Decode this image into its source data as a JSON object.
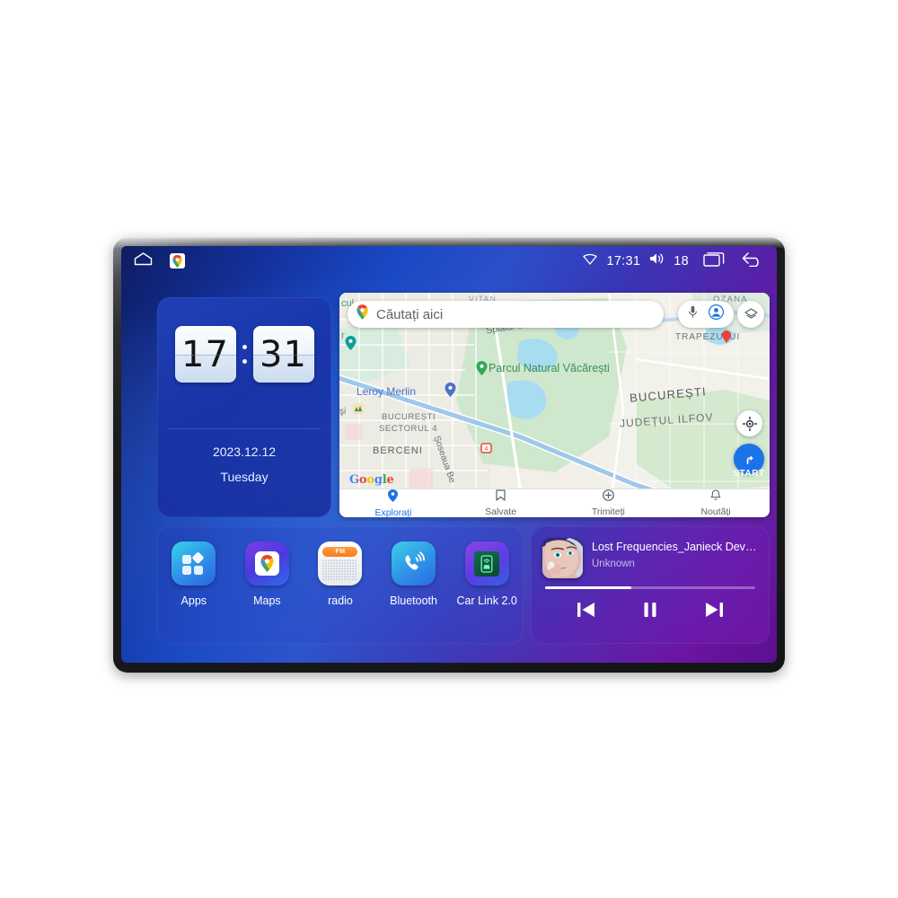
{
  "device": {
    "name": "car-head-unit"
  },
  "statusbar": {
    "home_icon": "home-icon",
    "maps_icon": "google-maps-icon",
    "wifi_icon": "wifi-icon",
    "time": "17:31",
    "volume_icon": "volume-icon",
    "volume_level": "18",
    "recents_icon": "recents-icon",
    "back_icon": "back-icon"
  },
  "clock_widget": {
    "hours": "17",
    "minutes": "31",
    "date": "2023.12.12",
    "weekday": "Tuesday"
  },
  "map": {
    "search": {
      "placeholder": "Căutați aici",
      "pin_icon": "map-pin-icon"
    },
    "mic_icon": "microphone-icon",
    "account_icon": "account-avatar-icon",
    "layers_icon": "map-layers-icon",
    "locate_icon": "my-location-icon",
    "start_icon": "navigation-arrow-icon",
    "start_label": "START",
    "attribution": "Google",
    "labels": [
      {
        "text": "Splaiul Unirii",
        "kind": "road"
      },
      {
        "text": "Parcul Natural Văcărești",
        "kind": "park"
      },
      {
        "text": "Leroy Merlin",
        "kind": "poi"
      },
      {
        "text": "BUCUREȘTI",
        "kind": "city"
      },
      {
        "text": "JUDEȚUL ILFOV",
        "kind": "county"
      },
      {
        "text": "TRAPEZULUI",
        "kind": "district"
      },
      {
        "text": "OZANA",
        "kind": "district"
      },
      {
        "text": "BUCUREȘTI",
        "kind": "district"
      },
      {
        "text": "SECTORUL 4",
        "kind": "district"
      },
      {
        "text": "BERCENI",
        "kind": "district"
      },
      {
        "text": "Șoseaua Be",
        "kind": "road"
      },
      {
        "text": "cul",
        "kind": "fragment"
      },
      {
        "text": "şi",
        "kind": "fragment"
      },
      {
        "text": "r",
        "kind": "fragment"
      },
      {
        "text": "VITAN",
        "kind": "district"
      }
    ],
    "bottom_nav": [
      {
        "label": "Explorați",
        "icon": "explore-pin-icon",
        "active": true
      },
      {
        "label": "Salvate",
        "icon": "bookmark-icon",
        "active": false
      },
      {
        "label": "Trimiteți",
        "icon": "contribute-plus-icon",
        "active": false
      },
      {
        "label": "Noutăți",
        "icon": "bell-icon",
        "active": false
      }
    ]
  },
  "apps": [
    {
      "label": "Apps",
      "icon": "apps-grid-icon"
    },
    {
      "label": "Maps",
      "icon": "google-maps-icon"
    },
    {
      "label": "radio",
      "icon": "fm-radio-icon",
      "badge": "FM"
    },
    {
      "label": "Bluetooth",
      "icon": "bluetooth-phone-icon"
    },
    {
      "label": "Car Link 2.0",
      "icon": "car-link-icon"
    }
  ],
  "music": {
    "title": "Lost Frequencies_Janieck Devy-...",
    "artist": "Unknown",
    "album_art": "album-artwork",
    "progress_percent": 41,
    "prev_icon": "previous-track-icon",
    "play_pause_icon": "pause-icon",
    "next_icon": "next-track-icon"
  },
  "colors": {
    "accent_blue": "#1a73e8",
    "wallpaper_blue": "#1a48c4",
    "wallpaper_purple": "#6d14a2",
    "bezel": "#2b2d30"
  }
}
